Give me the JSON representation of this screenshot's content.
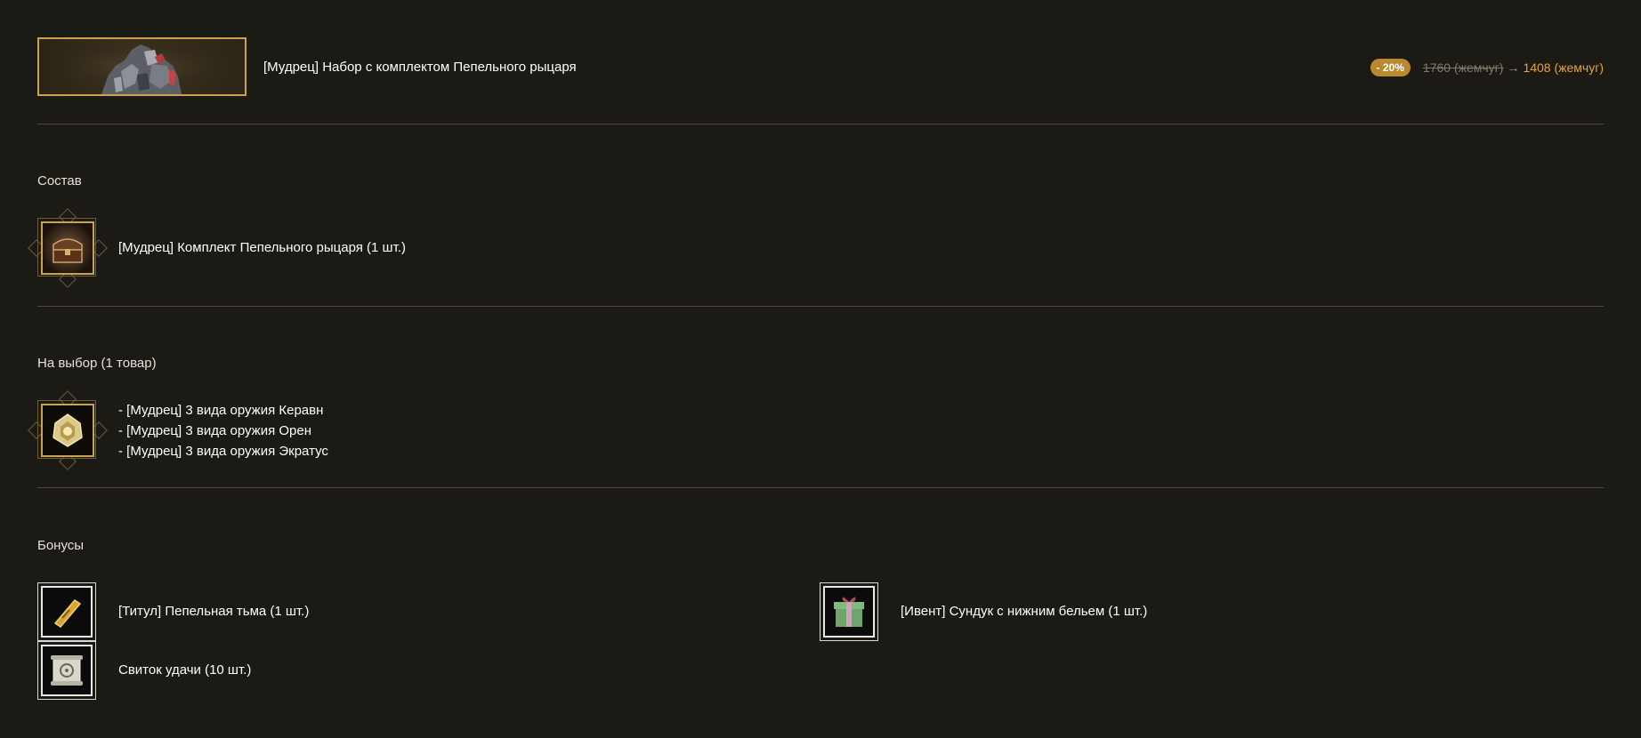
{
  "product": {
    "title": "[Мудрец] Набор с комплектом Пепельного рыцаря",
    "discount_badge": "- 20%",
    "old_price": "1760 (жемчуг)",
    "arrow": "→",
    "new_price": "1408 (жемчуг)",
    "banner_icon": "knight-armor-image"
  },
  "contents": {
    "title": "Состав",
    "items": [
      {
        "label": "[Мудрец] Комплект Пепельного рыцаря (1 шт.)",
        "icon": "chest-icon"
      }
    ]
  },
  "choice": {
    "title": "На выбор (1 товар)",
    "icon": "weapon-box-icon",
    "options": [
      "- [Мудрец] 3 вида оружия Керавн",
      "- [Мудрец] 3 вида оружия Орен",
      "- [Мудрец] 3 вида оружия Экратус"
    ]
  },
  "bonuses": {
    "title": "Бонусы",
    "items": [
      {
        "label": "[Титул] Пепельная тьма (1 шт.)",
        "icon": "title-ticket-icon"
      },
      {
        "label": "[Ивент] Сундук с нижним бельем (1 шт.)",
        "icon": "gift-box-icon"
      },
      {
        "label": "Свиток удачи (10 шт.)",
        "icon": "scroll-icon"
      }
    ]
  },
  "colors": {
    "background": "#1b1a14",
    "accent_gold": "#c9a34f",
    "price_orange": "#e5a43d",
    "badge": "#b8892f"
  }
}
